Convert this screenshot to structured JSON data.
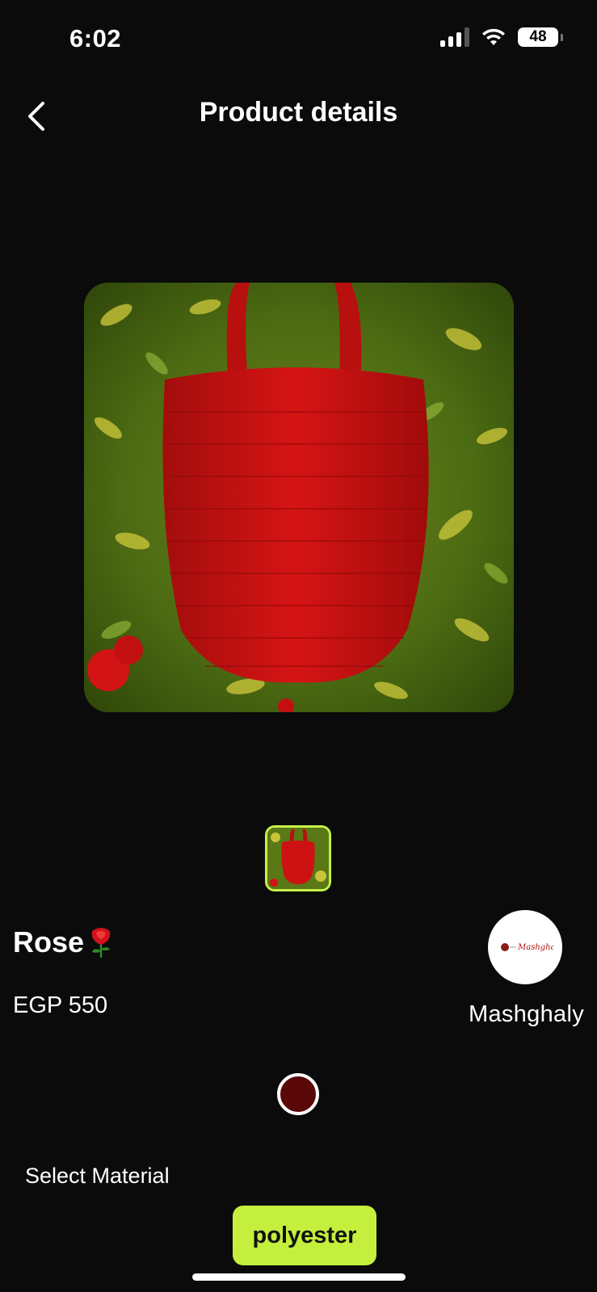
{
  "status_bar": {
    "time": "6:02",
    "battery": "48"
  },
  "header": {
    "title": "Product details",
    "back_icon": "chevron-left-icon"
  },
  "product": {
    "name": "Rose",
    "name_emoji": "🌹",
    "price": "EGP 550",
    "image_alt": "red crochet bag"
  },
  "seller": {
    "name": "Mashghaly",
    "logo_text": "Mashghaly"
  },
  "color": {
    "selected": "#5b0808"
  },
  "material": {
    "label": "Select Material",
    "options": [
      "polyester"
    ],
    "selected": "polyester"
  },
  "colors": {
    "accent": "#c4ef3c",
    "background": "#0b0b0b"
  }
}
